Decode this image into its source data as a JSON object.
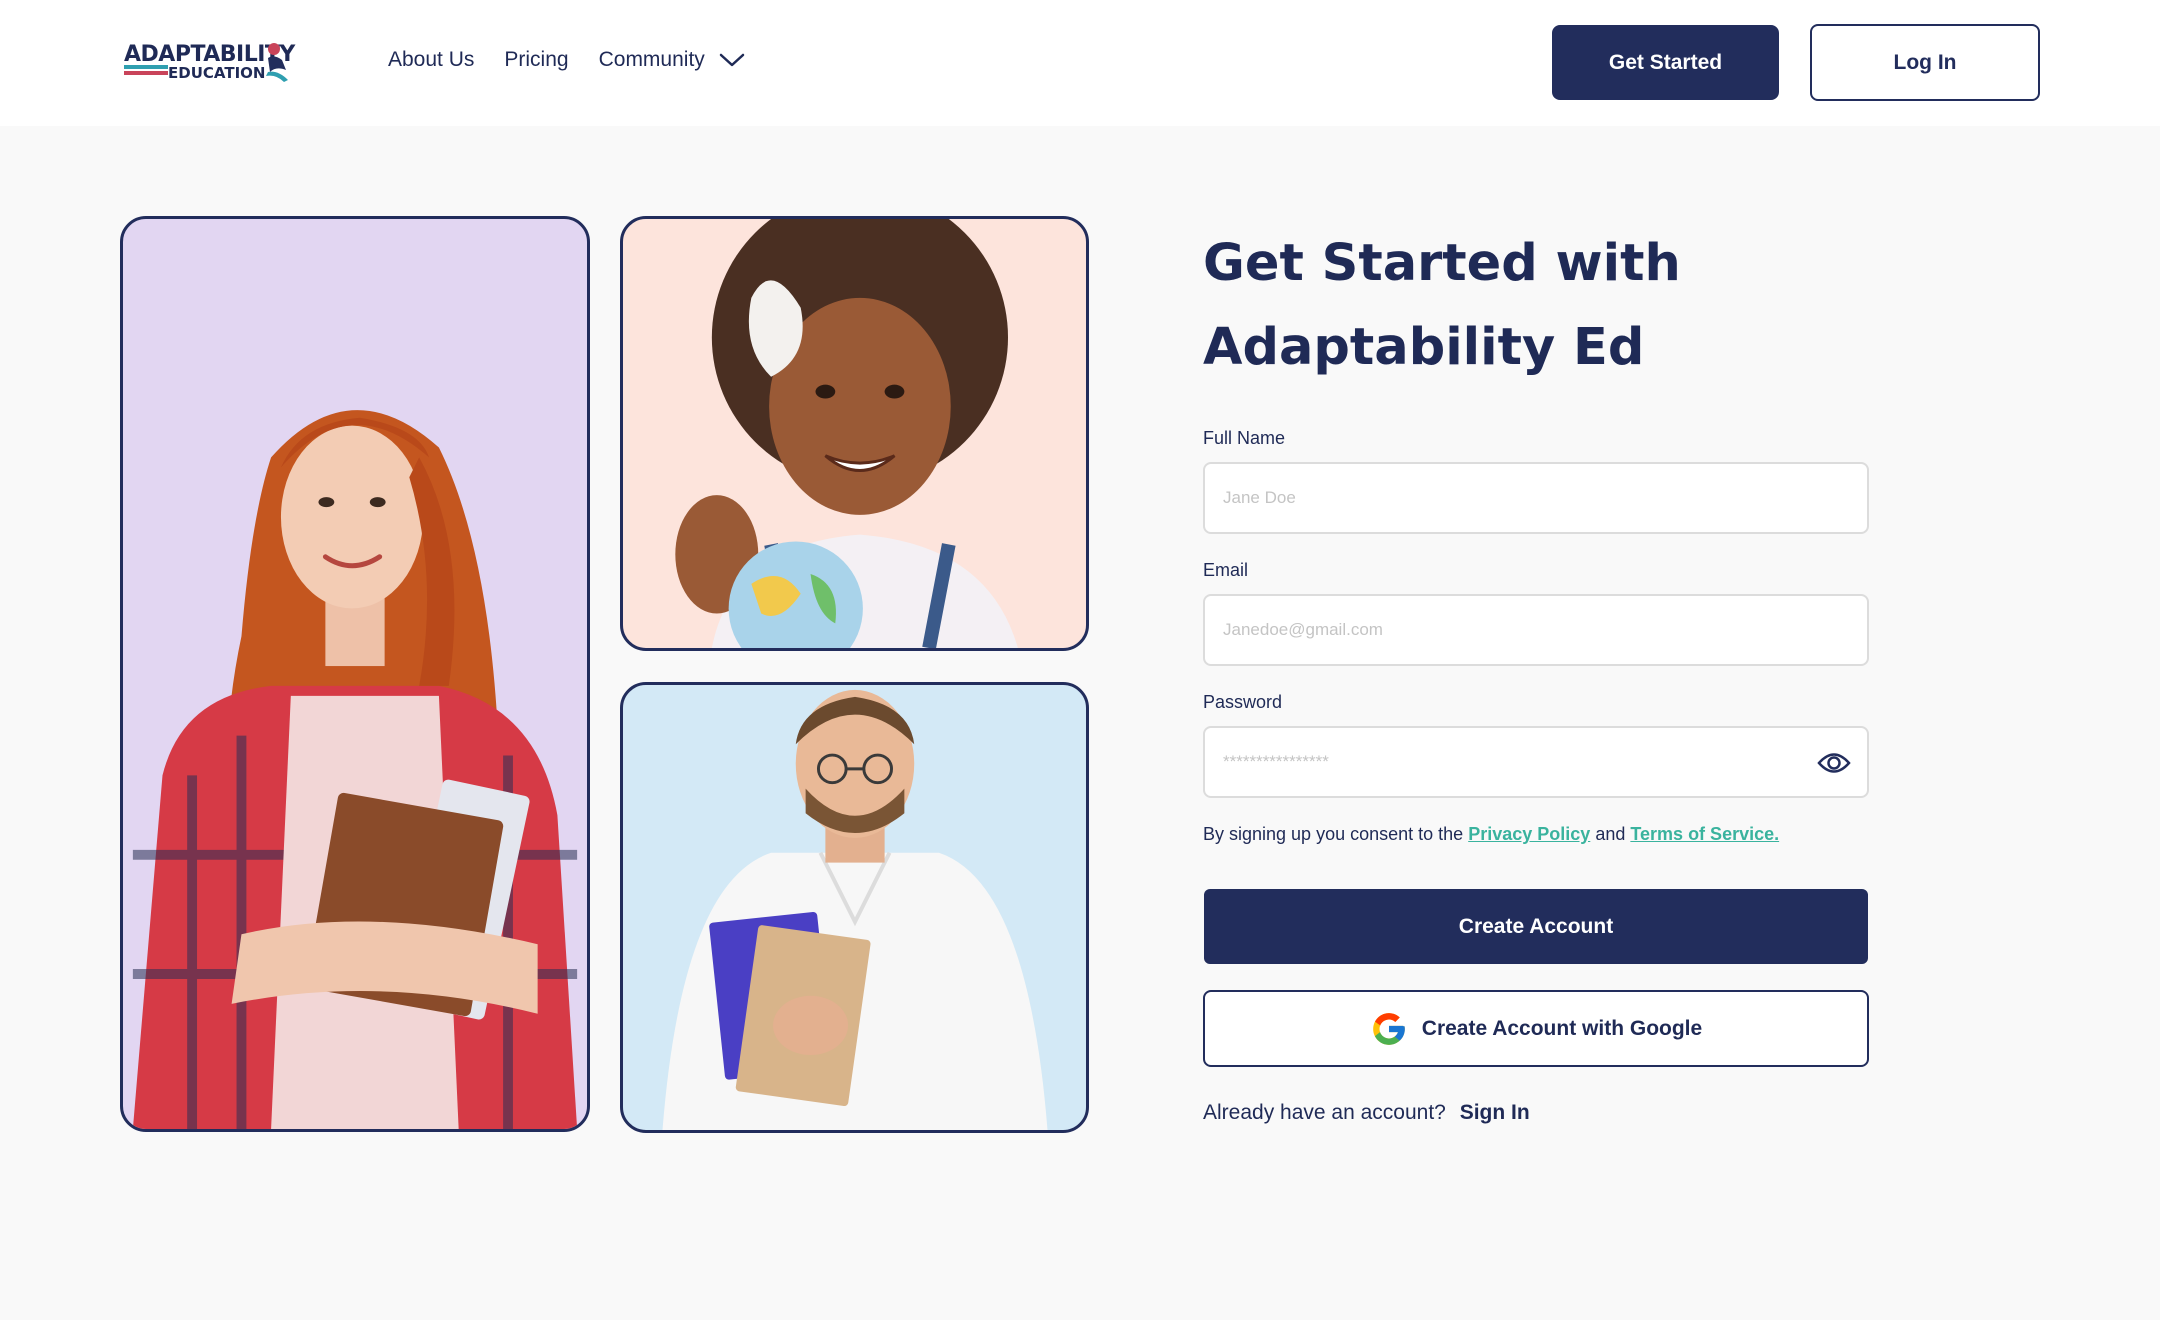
{
  "brand": {
    "logo_top": "ADAPTABILITY",
    "logo_bottom": "EDUCATION",
    "colors": {
      "navy": "#222d5c",
      "teal": "#3ab39e",
      "lavender": "#e2d6f2",
      "peach": "#fde4dc",
      "sky": "#d3e9f6"
    }
  },
  "nav": {
    "about": "About Us",
    "pricing": "Pricing",
    "community": "Community",
    "community_icon": "chevron-down-icon",
    "get_started": "Get Started",
    "login": "Log In"
  },
  "form": {
    "title": "Get Started with Adaptability Ed",
    "full_name_label": "Full Name",
    "full_name_placeholder": "Jane Doe",
    "email_label": "Email",
    "email_placeholder": "Janedoe@gmail.com",
    "password_label": "Password",
    "password_placeholder": "****************",
    "password_icon": "eye-icon",
    "consent_text": "By signing up you consent to the",
    "privacy_link": "Privacy Policy",
    "and_text": "and",
    "terms_link": "Terms of Service.",
    "create_account": "Create Account",
    "create_google": "Create Account with Google",
    "google_icon": "google-icon",
    "already_text": "Already have an account?",
    "sign_in": "Sign In"
  }
}
